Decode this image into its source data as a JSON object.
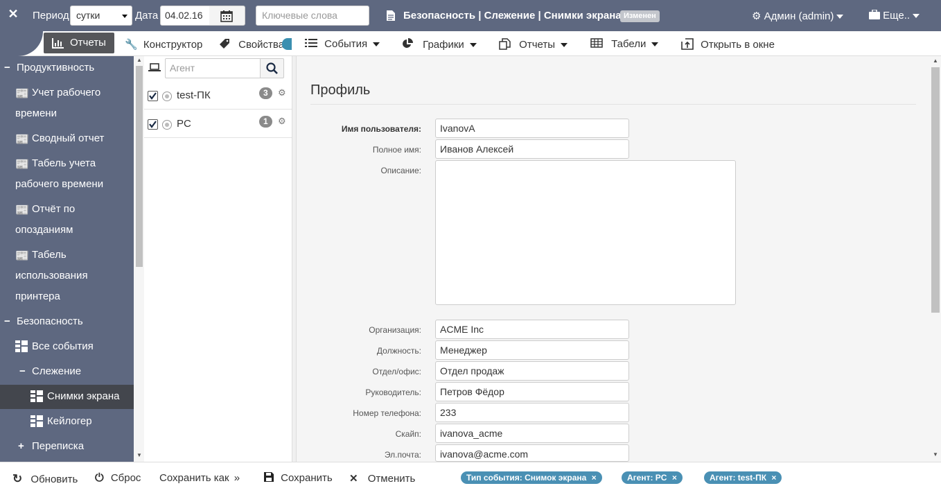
{
  "topbar": {
    "close_glyph": "✕",
    "period_label": "Период",
    "period_value": "сутки",
    "date_label": "Дата",
    "date_value": "04.02.16",
    "keywords_placeholder": "Ключевые слова",
    "breadcrumb": "Безопасность | Слежение | Снимки экрана",
    "status_badge": "Изменен",
    "user_menu": "Админ (admin)",
    "more_menu": "Еще.."
  },
  "toolbar": {
    "tab_reports": "Отчеты",
    "tab_constructor": "Конструктор",
    "tab_properties": "Свойства",
    "events": "События",
    "charts": "Графики",
    "reports": "Отчеты",
    "timesheets": "Табели",
    "open_in_window": "Открыть в окне"
  },
  "sidebar": {
    "productivity": "Продуктивность",
    "work_time_1": "Учет рабочего",
    "work_time_2": "времени",
    "summary": "Сводный отчет",
    "timesheet_1": "Табель учета",
    "timesheet_2": "рабочего времени",
    "late_1": "Отчёт по",
    "late_2": "опозданиям",
    "printer_1": "Табель",
    "printer_2": "использования",
    "printer_3": "принтера",
    "security": "Безопасность",
    "all_events": "Все события",
    "tracking": "Слежение",
    "screenshots": "Снимки экрана",
    "keylogger": "Кейлогер",
    "correspondence": "Переписка"
  },
  "agents": {
    "search_placeholder": "Агент",
    "items": [
      {
        "name": "test-ПК",
        "count": "3"
      },
      {
        "name": "PC",
        "count": "1"
      }
    ]
  },
  "profile": {
    "title": "Профиль",
    "username_label": "Имя пользователя:",
    "username": "IvanovA",
    "fullname_label": "Полное имя:",
    "fullname": "Иванов Алексей",
    "description_label": "Описание:",
    "description": "",
    "org_label": "Организация:",
    "org": "ACME Inc",
    "position_label": "Должность:",
    "position": "Менеджер",
    "dept_label": "Отдел/офис:",
    "dept": "Отдел продаж",
    "manager_label": "Руководитель:",
    "manager": "Петров Фёдор",
    "phone_label": "Номер телефона:",
    "phone": "233",
    "skype_label": "Скайп:",
    "skype": "ivanova_acme",
    "email_label": "Эл.почта:",
    "email": "ivanova@acme.com"
  },
  "bottom": {
    "refresh": "Обновить",
    "reset": "Сброс",
    "save_as": "Сохранить как",
    "save": "Сохранить",
    "cancel": "Отменить",
    "filters": [
      "Тип события: Снимок экрана",
      "Агент: PC",
      "Агент: test-ПК"
    ]
  },
  "colors": {
    "sidebar_bg": "#5e6880",
    "active_item_bg": "#43464d",
    "chip_bg": "#4a90b4"
  }
}
